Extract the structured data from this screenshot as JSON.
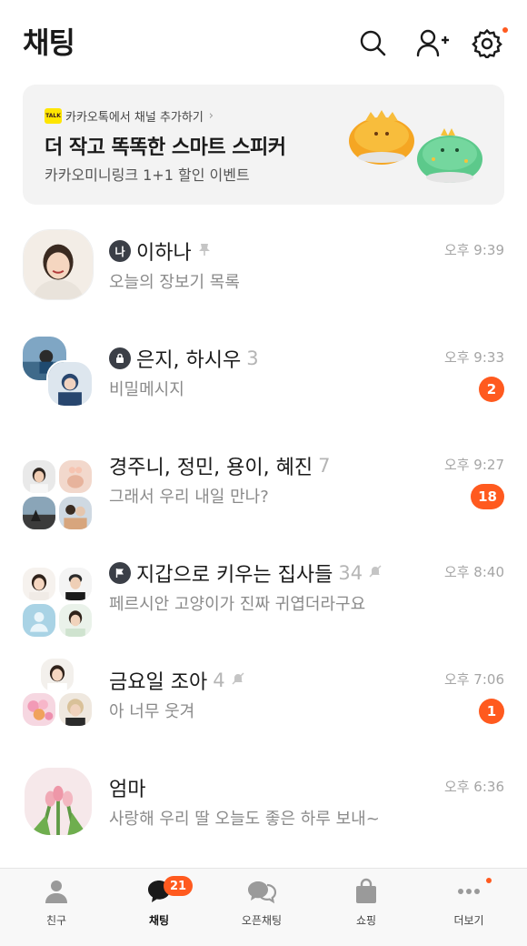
{
  "header": {
    "title": "채팅"
  },
  "banner": {
    "channel_label": "카카오톡에서 채널 추가하기",
    "logo_text": "TALK",
    "title": "더 작고 똑똑한 스마트 스피커",
    "subtitle": "카카오미니링크 1+1 할인 이벤트"
  },
  "chats": [
    {
      "name": "이하나",
      "badge": "나",
      "message": "오늘의 장보기 목록",
      "time": "오후 9:39"
    },
    {
      "name": "은지, 하시우",
      "count": "3",
      "message": "비밀메시지",
      "time": "오후 9:33",
      "unread": "2"
    },
    {
      "name": "경주니, 정민, 용이, 혜진",
      "count": "7",
      "message": "그래서 우리 내일 만나?",
      "time": "오후 9:27",
      "unread": "18"
    },
    {
      "name": "지갑으로 키우는 집사들",
      "count": "34",
      "message": "페르시안 고양이가 진짜 귀엽더라구요",
      "time": "오후 8:40"
    },
    {
      "name": "금요일 조아",
      "count": "4",
      "message": "아 너무 웃겨",
      "time": "오후 7:06",
      "unread": "1"
    },
    {
      "name": "엄마",
      "message": "사랑해 우리 딸 오늘도 좋은 하루 보내~",
      "time": "오후 6:36"
    }
  ],
  "tabs": [
    {
      "label": "친구",
      "icon": "person-icon"
    },
    {
      "label": "채팅",
      "icon": "chat-bubble-icon",
      "badge": "21"
    },
    {
      "label": "오픈채팅",
      "icon": "open-chat-icon"
    },
    {
      "label": "쇼핑",
      "icon": "shopping-bag-icon"
    },
    {
      "label": "더보기",
      "icon": "more-icon"
    }
  ],
  "colors": {
    "accent": "#ff5a1f",
    "tabbar": "#f8f8f8",
    "banner": "#f3f3f3"
  }
}
